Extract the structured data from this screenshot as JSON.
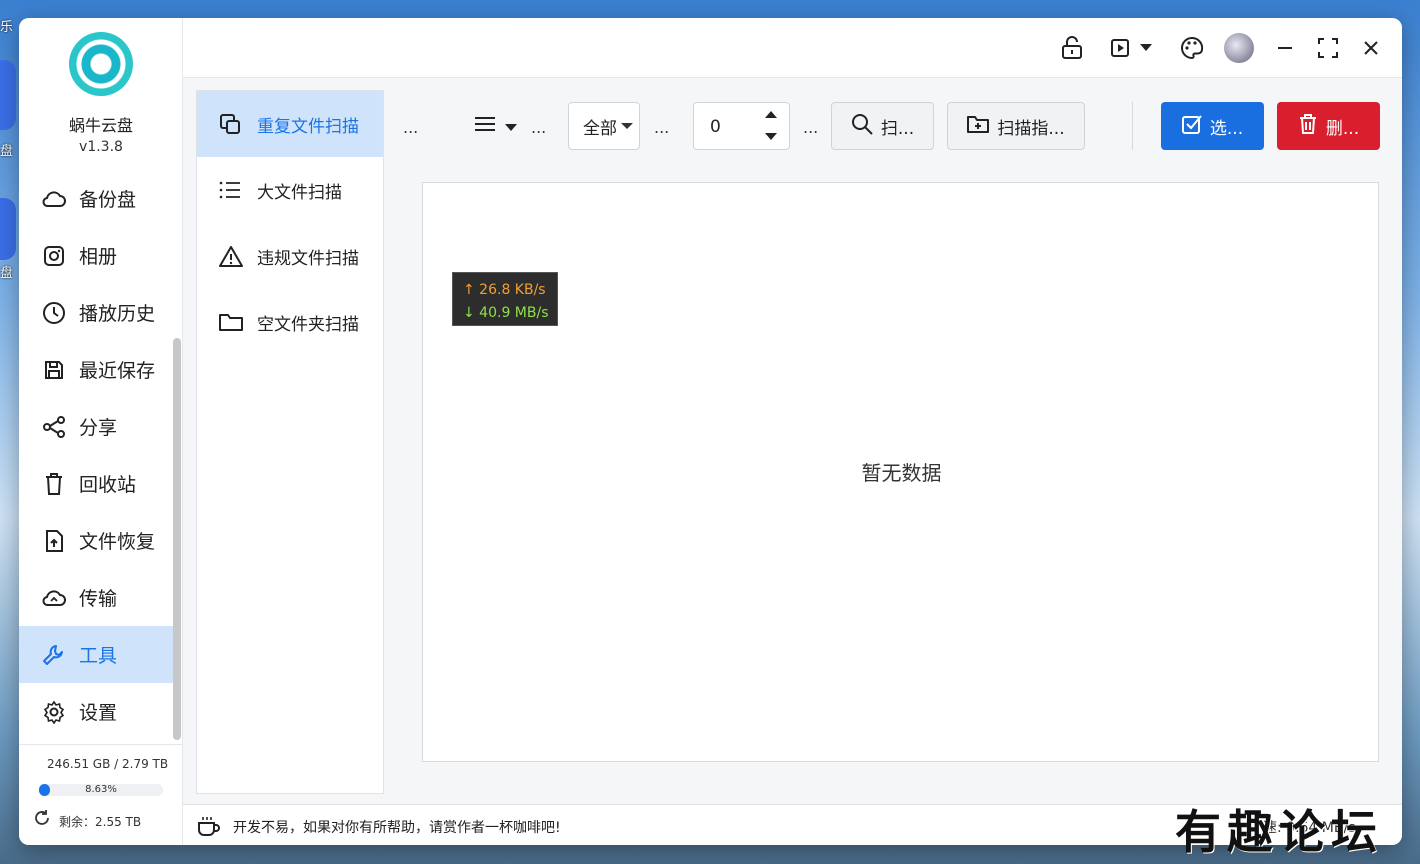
{
  "desktop": {
    "labels": [
      "乐",
      "盘",
      "盘"
    ]
  },
  "app": {
    "name": "蜗牛云盘",
    "version": "v1.3.8"
  },
  "sidebar": {
    "items": [
      {
        "label": "备份盘",
        "icon": "cloud-icon"
      },
      {
        "label": "相册",
        "icon": "camera-icon"
      },
      {
        "label": "播放历史",
        "icon": "clock-icon"
      },
      {
        "label": "最近保存",
        "icon": "save-icon"
      },
      {
        "label": "分享",
        "icon": "share-icon"
      },
      {
        "label": "回收站",
        "icon": "trash-icon"
      },
      {
        "label": "文件恢复",
        "icon": "file-restore-icon"
      },
      {
        "label": "传输",
        "icon": "transfer-icon"
      },
      {
        "label": "工具",
        "icon": "wrench-icon"
      },
      {
        "label": "设置",
        "icon": "gear-icon"
      }
    ],
    "active_index": 8
  },
  "storage": {
    "used_total": "246.51 GB / 2.79 TB",
    "percent_label": "8.63%",
    "percent_value": 8.63,
    "remaining": "剩余：2.55 TB"
  },
  "titlebar": {
    "icons": [
      "unlock-icon",
      "play-icon",
      "dropdown-icon",
      "palette-icon",
      "avatar",
      "minimize-icon",
      "maximize-icon",
      "close-icon"
    ]
  },
  "tools": {
    "items": [
      {
        "label": "重复文件扫描",
        "icon": "copy-icon"
      },
      {
        "label": "大文件扫描",
        "icon": "list-icon"
      },
      {
        "label": "违规文件扫描",
        "icon": "warning-icon"
      },
      {
        "label": "空文件夹扫描",
        "icon": "folder-icon"
      }
    ],
    "active_index": 0
  },
  "toolbar": {
    "dots": "...",
    "filter_value": "全部",
    "number_value": "0",
    "scan_label": "扫...",
    "scan_folder_label": "扫描指...",
    "select_label": "选...",
    "delete_label": "删..."
  },
  "panel": {
    "empty_text": "暂无数据"
  },
  "speed": {
    "upload": "↑ 26.8 KB/s",
    "download": "↓ 40.9 MB/s"
  },
  "statusbar": {
    "message": "开发不易，如果对你有所帮助，请赏作者一杯咖啡吧!",
    "right_text": "速: 0.64 MB/s"
  },
  "watermark": "有趣论坛"
}
